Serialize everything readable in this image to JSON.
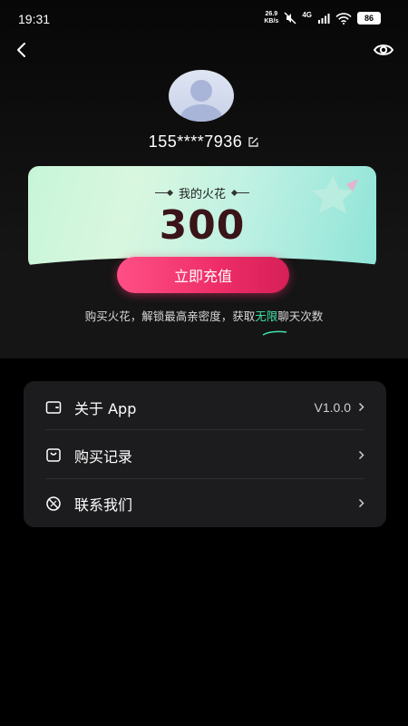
{
  "status_bar": {
    "time": "19:31",
    "net_speed_value": "26.9",
    "net_speed_unit": "KB/s",
    "network_type": "4G",
    "battery": "86"
  },
  "profile": {
    "phone": "155****7936"
  },
  "spark_card": {
    "label": "我的火花",
    "value": "300"
  },
  "recharge": {
    "button_label": "立即充值",
    "promo_before": "购买火花，解锁最高亲密度，获取",
    "promo_highlight": "无限",
    "promo_after": "聊天次数"
  },
  "menu": {
    "items": [
      {
        "label": "关于 App",
        "value": "V1.0.0",
        "icon": "wallet-icon"
      },
      {
        "label": "购买记录",
        "value": "",
        "icon": "shopping-bag-icon"
      },
      {
        "label": "联系我们",
        "value": "",
        "icon": "contact-icon"
      }
    ]
  },
  "colors": {
    "background": "#000000",
    "card_bg": "#1c1c1e",
    "accent_pink": "#ee2d67",
    "highlight_green": "#3fe6a8",
    "spark_value": "#3a1418"
  }
}
